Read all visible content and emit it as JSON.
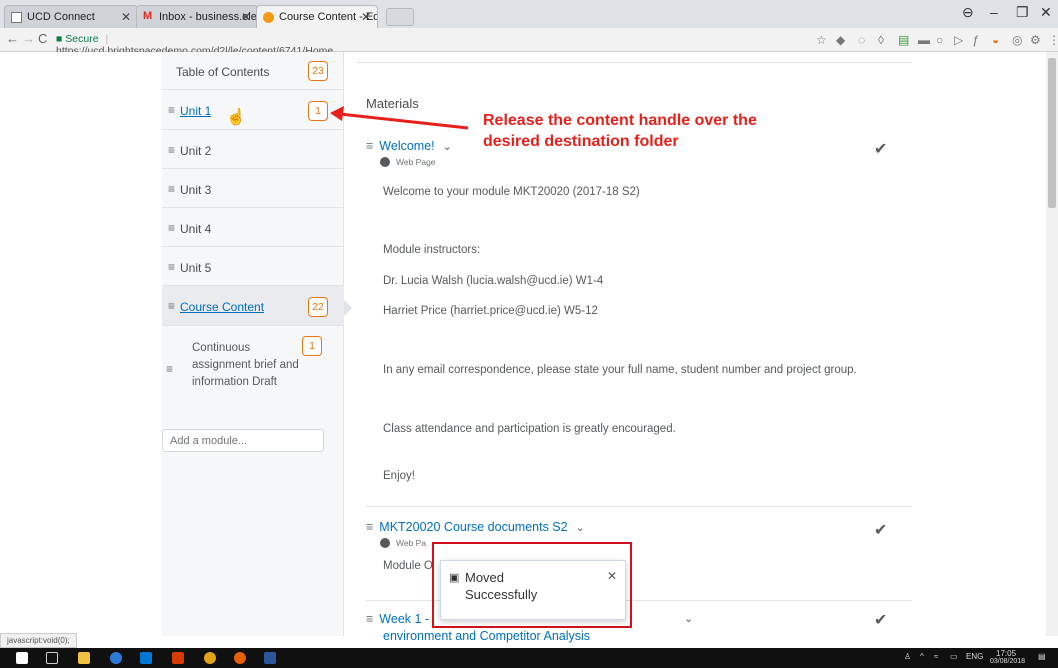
{
  "browser": {
    "tabs": [
      {
        "title": "UCD Connect"
      },
      {
        "title": "Inbox - business.elearnin"
      },
      {
        "title": "Course Content - EdTech"
      }
    ],
    "address": {
      "secure_label": "Secure",
      "url": "https://ucd.brightspacedemo.com/d2l/le/content/6741/Home"
    },
    "status_url": "javascript:void(0);"
  },
  "toc": {
    "title": "Table of Contents",
    "title_count": "23",
    "units": [
      {
        "label": "Unit 1",
        "count": "1"
      },
      {
        "label": "Unit 2"
      },
      {
        "label": "Unit 3"
      },
      {
        "label": "Unit 4"
      },
      {
        "label": "Unit 5"
      }
    ],
    "course_content": {
      "label": "Course Content",
      "count": "22"
    },
    "sub_item": {
      "label": "Continuous assignment brief and information Draft",
      "count": "1"
    },
    "add_module_placeholder": "Add a module..."
  },
  "content": {
    "section_title": "Materials",
    "topics": [
      {
        "title": "Welcome!",
        "type": "Web Page",
        "lines": [
          "Welcome to your module MKT20020 (2017-18 S2)",
          "Module instructors:",
          "Dr. Lucia Walsh (lucia.walsh@ucd.ie) W1-4",
          "Harriet Price (harriet.price@ucd.ie) W5-12",
          "In any email correspondence, please state your full name, student number and project group.",
          "Class attendance and participation is greatly encouraged.",
          "Enjoy!"
        ]
      },
      {
        "title": "MKT20020 Course documents S2",
        "type": "Web Pa",
        "line": "Module O"
      },
      {
        "title_part1": "Week 1 -",
        "title_part2": "environment and Competitor Analysis"
      }
    ]
  },
  "annotation": {
    "line1": "Release the content handle over the",
    "line2": "desired destination folder"
  },
  "toast": {
    "line1": "Moved",
    "line2": "Successfully"
  },
  "taskbar": {
    "lang": "ENG",
    "time": "17:05",
    "date": "03/08/2018"
  },
  "colors": {
    "accent_link": "#006fbf",
    "badge_orange": "#e87511",
    "annotation_red": "#e8201b",
    "highlight_box": "#d0121c"
  }
}
